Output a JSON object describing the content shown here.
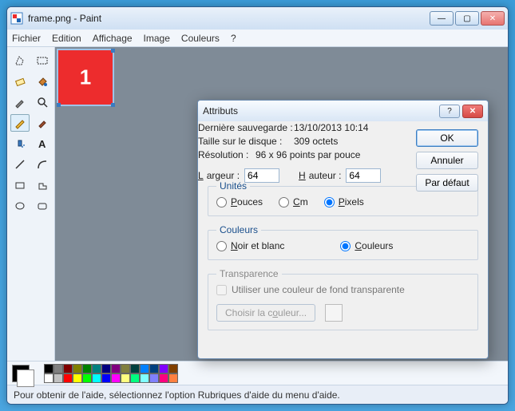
{
  "window": {
    "title": "frame.png - Paint",
    "minimize": "—",
    "maximize": "▢",
    "close": "✕"
  },
  "menu": {
    "file": "Fichier",
    "edit": "Edition",
    "view": "Affichage",
    "image": "Image",
    "colors": "Couleurs",
    "help": "?"
  },
  "canvas": {
    "label": "1"
  },
  "palette_colors": [
    "#000000",
    "#808080",
    "#800000",
    "#808000",
    "#008000",
    "#008080",
    "#000080",
    "#800080",
    "#808040",
    "#004040",
    "#0080ff",
    "#004080",
    "#8000ff",
    "#804000",
    "#ffffff",
    "#c0c0c0",
    "#ff0000",
    "#ffff00",
    "#00ff00",
    "#00ffff",
    "#0000ff",
    "#ff00ff",
    "#ffff80",
    "#00ff80",
    "#80ffff",
    "#8080ff",
    "#ff0080",
    "#ff8040"
  ],
  "statusbar": "Pour obtenir de l'aide, sélectionnez l'option Rubriques d'aide du menu d'aide.",
  "dialog": {
    "title": "Attributs",
    "help": "?",
    "close": "✕",
    "last_save_label": "Dernière sauvegarde :",
    "last_save_value": "13/10/2013 10:14",
    "disk_size_label": "Taille sur le disque :",
    "disk_size_value": "309 octets",
    "resolution_label": "Résolution :",
    "resolution_value": "96 x 96 points par pouce",
    "width_label_u": "L",
    "width_label_rest": "argeur :",
    "width_value": "64",
    "height_label_u": "H",
    "height_label_rest": "auteur :",
    "height_value": "64",
    "units_legend": "Unités",
    "unit_inches_u": "P",
    "unit_inches": "ouces",
    "unit_cm_u": "C",
    "unit_cm": "m",
    "unit_px_u": "P",
    "unit_px": "ixels",
    "colors_legend": "Couleurs",
    "bw_u": "N",
    "bw": "oir et blanc",
    "colors_u": "C",
    "colors": "ouleurs",
    "trans_legend": "Transparence",
    "trans_check": "Utiliser une couleur de fond transparente",
    "choose_color_pre": "Choisir la c",
    "choose_color_u": "o",
    "choose_color_post": "uleur...",
    "ok": "OK",
    "cancel": "Annuler",
    "default": "Par défaut"
  }
}
